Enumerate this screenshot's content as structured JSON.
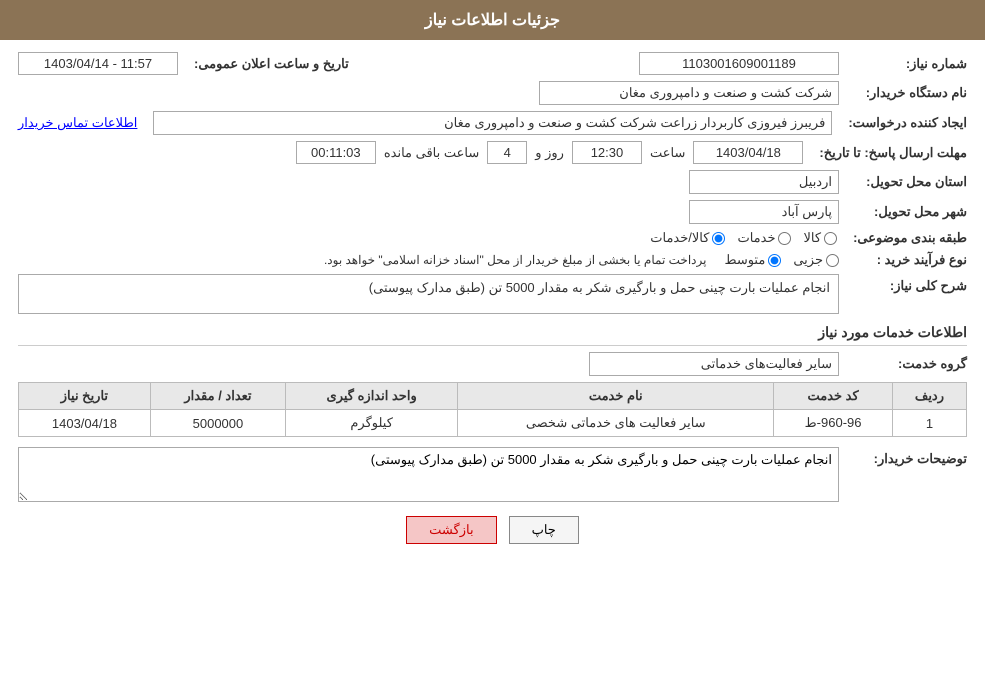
{
  "header": {
    "title": "جزئیات اطلاعات نیاز"
  },
  "fields": {
    "shomareNiaz_label": "شماره نیاز:",
    "shomareNiaz_value": "1103001609001189",
    "namDastgahKhardar_label": "نام دستگاه خریدار:",
    "namDastgahKhardar_value": "شرکت کشت و صنعت و دامپروری مغان",
    "ijadKarande_label": "ایجاد کننده درخواست:",
    "ijadKarande_value": "فریبرز فیروزی کاربردار زراعت شرکت کشت و صنعت و دامپروری مغان",
    "aetelaatTamas_link": "اطلاعات تماس خریدار",
    "mohlatErsalPasox_label": "مهلت ارسال پاسخ: تا تاریخ:",
    "date_value": "1403/04/18",
    "saat_label": "ساعت",
    "saat_value": "12:30",
    "roz_label": "روز و",
    "roz_value": "4",
    "saatBaqi_label": "ساعت باقی مانده",
    "saatBaqi_value": "00:11:03",
    "takhKhAelan_label": "تاریخ و ساعت اعلان عمومی:",
    "takhKhAelan_value": "1403/04/14 - 11:57",
    "ostan_label": "استان محل تحویل:",
    "ostan_value": "اردبیل",
    "shahr_label": "شهر محل تحویل:",
    "shahr_value": "پارس آباد",
    "tabaqeBandi_label": "طبقه بندی موضوعی:",
    "radio_kala": "کالا",
    "radio_khadamat": "خدمات",
    "radio_kala_khadamat": "کالا/خدمات",
    "novFarayand_label": "نوع فرآیند خرید :",
    "radio_jozi": "جزیی",
    "radio_mottaset": "متوسط",
    "novFarayand_desc": "پرداخت تمام یا بخشی از مبلغ خریدار از محل \"اسناد خزانه اسلامی\" خواهد بود.",
    "sharhKolliNiaz_label": "شرح کلی نیاز:",
    "sharhKolliNiaz_value": "انجام عملیات بارت چینی حمل و بارگیری شکر به مقدار 5000 تن (طبق مدارک پیوستی)",
    "khadamatSection_label": "اطلاعات خدمات مورد نیاز",
    "groupKhadamat_label": "گروه خدمت:",
    "groupKhadamat_value": "سایر فعالیت‌های خدماتی",
    "table": {
      "headers": [
        "ردیف",
        "کد خدمت",
        "نام خدمت",
        "واحد اندازه گیری",
        "تعداد / مقدار",
        "تاریخ نیاز"
      ],
      "rows": [
        {
          "radif": "1",
          "kodKhadamat": "960-96-ط",
          "namKhadamat": "سایر فعالیت های خدماتی شخصی",
          "vahed": "کیلوگرم",
          "tedad": "5000000",
          "tarikh": "1403/04/18"
        }
      ]
    },
    "tozihatKhardar_label": "توضیحات خریدار:",
    "tozihatKhardar_value": "انجام عملیات بارت چینی حمل و بارگیری شکر به مقدار 5000 تن (طبق مدارک پیوستی)"
  },
  "buttons": {
    "print_label": "چاپ",
    "back_label": "بازگشت"
  }
}
